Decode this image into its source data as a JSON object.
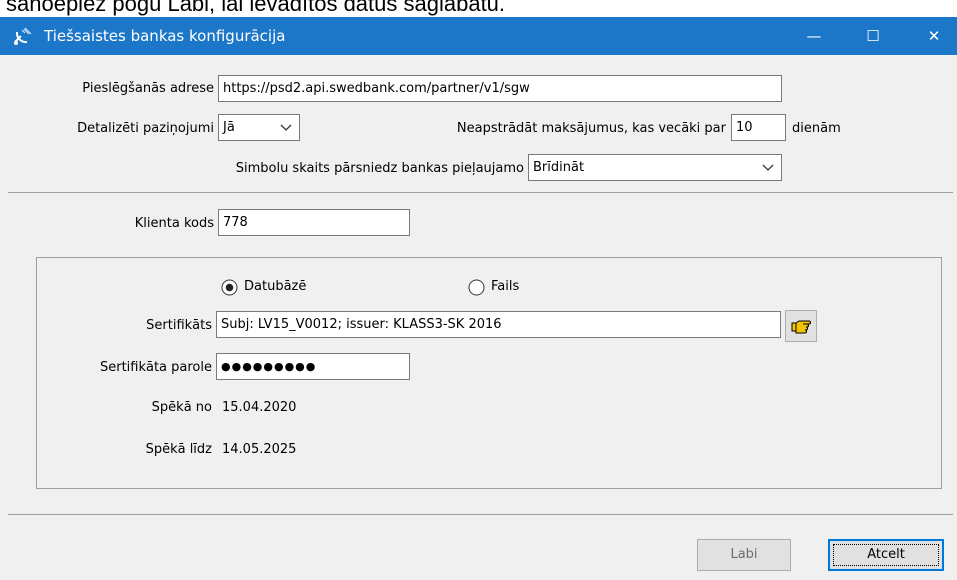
{
  "caption_text": "sanoepiez pogu Labi, lai ievadītos datus saglabātu.",
  "window": {
    "title": "Tiešsaistes bankas konfigurācija",
    "minimize": "—",
    "maximize": "☐",
    "close": "✕",
    "titlebar_color": "#1d77c8"
  },
  "form": {
    "address_label": "Pieslēgšanās adrese",
    "address_value": "https://psd2.api.swedbank.com/partner/v1/sgw",
    "detailed_label": "Detalizēti paziņojumi",
    "detailed_value": "Jā",
    "skip_label": "Neapstrādāt maksājumus, kas vecāki par",
    "skip_value": "10",
    "skip_unit": "dienām",
    "symbols_label": "Simbolu skaits pārsniedz bankas pieļaujamo",
    "symbols_value": "Brīdināt",
    "client_code_label": "Klienta kods",
    "client_code_value": "778"
  },
  "certificate": {
    "radio_db": "Datubāzē",
    "radio_file": "Fails",
    "selected": "Datubāzē",
    "cert_label": "Sertifikāts",
    "cert_value": "Subj: LV15_V0012; issuer: KLASS3-SK 2016",
    "password_label": "Sertifikāta parole",
    "password_value": "●●●●●●●●●",
    "valid_from_label": "Spēkā no",
    "valid_from_value": "15.04.2020",
    "valid_to_label": "Spēkā līdz",
    "valid_to_value": "14.05.2025"
  },
  "buttons": {
    "ok": "Labi",
    "cancel": "Atcelt"
  },
  "icons": {
    "title": "satellite-dish-icon",
    "pick": "pointing-hand-icon"
  }
}
